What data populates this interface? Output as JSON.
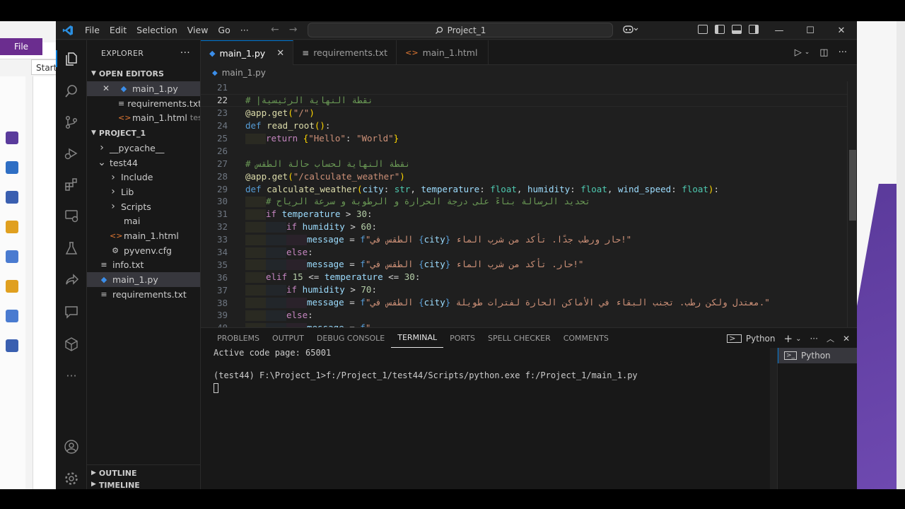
{
  "window": {
    "menu": [
      "File",
      "Edit",
      "Selection",
      "View",
      "Go"
    ],
    "search_text": "Project_1"
  },
  "background_app": {
    "file_tab": "File",
    "start_tab": "Start"
  },
  "sidebar": {
    "title": "EXPLORER",
    "open_editors_label": "OPEN EDITORS",
    "open_editors": [
      {
        "name": "main_1.py",
        "kind": "py",
        "hint": ""
      },
      {
        "name": "requirements.txt",
        "kind": "txt",
        "hint": ""
      },
      {
        "name": "main_1.html",
        "kind": "html",
        "hint": "test..."
      }
    ],
    "project_label": "PROJECT_1",
    "tree": [
      {
        "name": "__pycache__",
        "kind": "folder",
        "depth": 1
      },
      {
        "name": "test44",
        "kind": "folder-open",
        "depth": 1
      },
      {
        "name": "Include",
        "kind": "folder",
        "depth": 2
      },
      {
        "name": "Lib",
        "kind": "folder",
        "depth": 2
      },
      {
        "name": "Scripts",
        "kind": "folder",
        "depth": 2
      },
      {
        "name": "mai",
        "kind": "file",
        "depth": 2
      },
      {
        "name": "main_1.html",
        "kind": "html",
        "depth": 2
      },
      {
        "name": "pyvenv.cfg",
        "kind": "cfg",
        "depth": 2
      },
      {
        "name": "info.txt",
        "kind": "txt",
        "depth": 1
      },
      {
        "name": "main_1.py",
        "kind": "py",
        "depth": 1
      },
      {
        "name": "requirements.txt",
        "kind": "txt",
        "depth": 1
      }
    ],
    "outline_label": "OUTLINE",
    "timeline_label": "TIMELINE"
  },
  "editor": {
    "tabs": [
      {
        "label": "main_1.py",
        "active": true
      },
      {
        "label": "requirements.txt",
        "active": false
      },
      {
        "label": "main_1.html",
        "active": false
      }
    ],
    "breadcrumb": "main_1.py",
    "first_line": 21,
    "current_line": 22
  },
  "panel": {
    "tabs": [
      "PROBLEMS",
      "OUTPUT",
      "DEBUG CONSOLE",
      "TERMINAL",
      "PORTS",
      "SPELL CHECKER",
      "COMMENTS"
    ],
    "active_tab": "TERMINAL",
    "terminal_name": "Python",
    "terminal_lines": [
      "Active code page: 65001",
      "",
      "(test44) F:\\Project_1>f:/Project_1/test44/Scripts/python.exe f:/Project_1/main_1.py"
    ],
    "terminal_list": [
      "Python"
    ]
  },
  "colors": {
    "accent": "#0078d4",
    "editor_bg": "#1f1f1f",
    "sidebar_bg": "#181818"
  }
}
